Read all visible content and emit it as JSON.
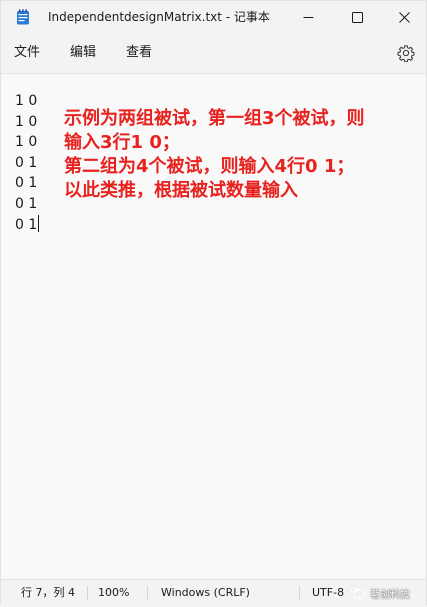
{
  "window": {
    "title": "IndependentdesignMatrix.txt - 记事本"
  },
  "menu": {
    "file": "文件",
    "edit": "编辑",
    "view": "查看"
  },
  "editor": {
    "lines": [
      "1 0",
      "1 0",
      "1 0",
      "0 1",
      "0 1",
      "0 1",
      "0 1"
    ],
    "annotation_lines": [
      "示例为两组被试，第一组3个被试，则",
      "输入3行1 0；",
      "第二组为4个被试，则输入4行0 1；",
      "以此类推，根据被试数量输入"
    ]
  },
  "statusbar": {
    "position": "行 7，列 4",
    "zoom": "100%",
    "line_ending": "Windows (CRLF)",
    "encoding": "UTF-8",
    "watermark": "茗创科技"
  },
  "colors": {
    "annotation": "#e8231f",
    "app_icon": "#2b7bd6"
  },
  "icons": {
    "app": "notepad-icon",
    "minimize": "minimize-icon",
    "maximize": "maximize-icon",
    "close": "close-icon",
    "settings": "gear-icon",
    "watermark": "wechat-icon"
  }
}
